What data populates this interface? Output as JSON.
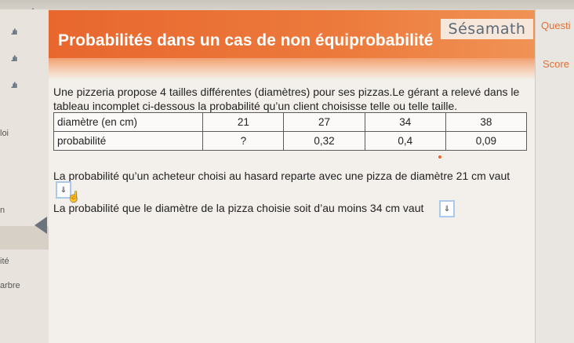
{
  "header": {
    "title": "Probabilités dans un cas de non équiprobabilité",
    "logo": "Sésamath"
  },
  "right_panel": {
    "question_label": "Questi",
    "score_label": "Score"
  },
  "sidebar": {
    "fragments": [
      "loi",
      "n",
      "ité",
      "arbre"
    ]
  },
  "exercise": {
    "intro": "Une pizzeria propose 4 tailles différentes (diamètres) pour ses pizzas.Le gérant a relevé dans le tableau incomplet ci-dessous la probabilité qu’un client choisisse telle ou telle taille.",
    "table": {
      "row1": [
        "diamètre (en cm)",
        "21",
        "27",
        "34",
        "38"
      ],
      "row2": [
        "probabilité",
        "?",
        "0,32",
        "0,4",
        "0,09"
      ]
    },
    "question1": "La probabilité qu’un acheteur choisi au hasard reparte avec une pizza de diamètre 21 cm vaut",
    "question2": "La probabilité que le diamètre de la pizza choisie soit d’au moins 34 cm vaut",
    "input_glyph": "⇓"
  },
  "colors": {
    "accent": "#e8672e",
    "input_border": "#a9c9ee"
  }
}
